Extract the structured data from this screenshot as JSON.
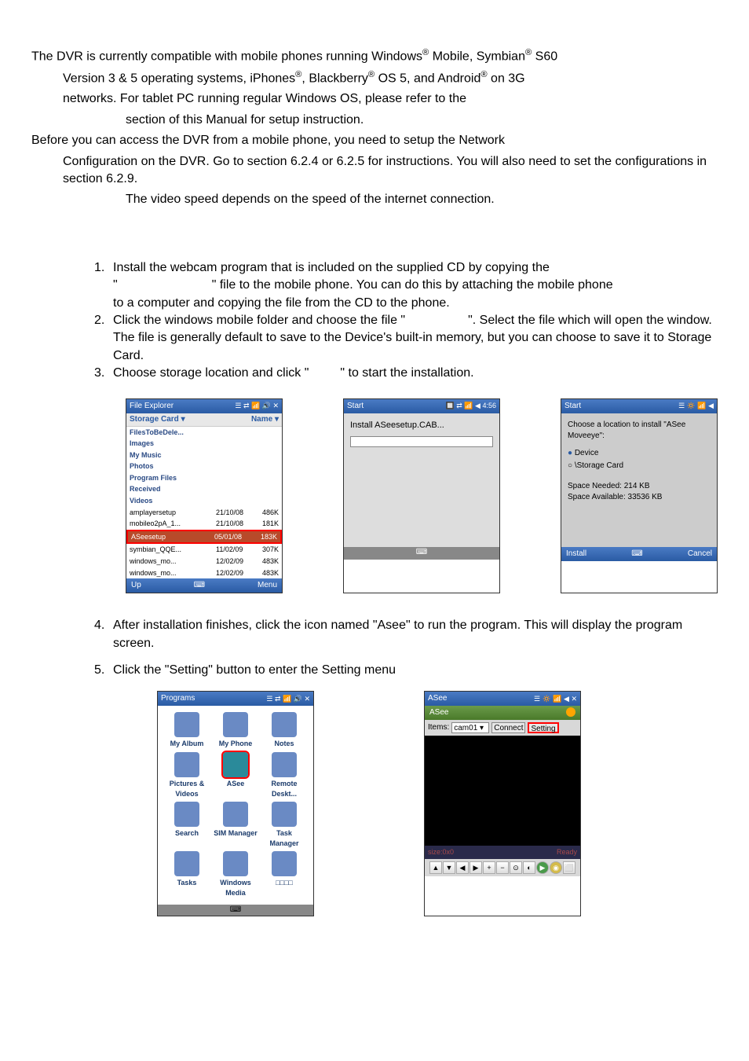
{
  "intro": {
    "p1a": "The DVR is currently compatible with mobile phones running Windows",
    "p1b": " Mobile, Symbian",
    "p1c": " S60",
    "p2a": "Version 3 & 5 operating systems, iPhones",
    "p2b": ", Blackberry",
    "p2c": " OS 5, and Android",
    "p2d": " on 3G",
    "p3": "networks.    For tablet PC running regular Windows OS, please refer to the",
    "p4": "section of this Manual for setup instruction.",
    "p5": "Before you can access the DVR from a mobile phone, you need to setup the Network",
    "p6": "Configuration on the DVR. Go to section 6.2.4 or 6.2.5 for instructions. You will also need to set the configurations in section 6.2.9.",
    "p7": "The video speed depends on the speed of the internet connection."
  },
  "steps": {
    "n1": "1.",
    "s1a": "Install the webcam program that is included on the supplied CD by copying the",
    "s1b": "\"",
    "s1c": "\" file to the mobile phone. You can do this by attaching the mobile phone",
    "s1d": "to a computer and copying the file from the CD to the phone.",
    "n2": "2.",
    "s2a": "Click the windows mobile folder and choose the file \"",
    "s2b": "\". Select the file which will open the window. The file is generally default to save to the Device's built-in memory, but you can choose to save it to Storage Card.",
    "n3": "3.",
    "s3a": "Choose storage location and click \"",
    "s3b": "\" to start the installation.",
    "n4": "4.",
    "s4": "After installation finishes, click the icon named \"Asee\" to run the program. This will display the program screen.",
    "n5": "5.",
    "s5": "Click the \"Setting\" button to enter the Setting menu"
  },
  "shot1": {
    "title": "File Explorer",
    "icons": "☰ ⇄ 📶 🔊 ✕",
    "dropdown": "Storage Card ▾",
    "nameCol": "Name ▾",
    "folders": [
      "FilesToBeDele...",
      "Images",
      "My Music",
      "Photos",
      "Program Files",
      "Received",
      "Videos"
    ],
    "files": [
      {
        "name": "amplayersetup",
        "date": "21/10/08",
        "size": "486K"
      },
      {
        "name": "mobileo2pA_1...",
        "date": "21/10/08",
        "size": "181K"
      },
      {
        "name": "ASeesetup",
        "date": "05/01/08",
        "size": "183K"
      },
      {
        "name": "symbian_QQE...",
        "date": "11/02/09",
        "size": "307K"
      },
      {
        "name": "windows_mo...",
        "date": "12/02/09",
        "size": "483K"
      },
      {
        "name": "windows_mo...",
        "date": "12/02/09",
        "size": "483K"
      }
    ],
    "btnLeft": "Up",
    "btnRight": "Menu"
  },
  "shot2": {
    "title": "Start",
    "icons": "🔲 ⇄ 📶 ◀ 4:56",
    "text": "Install ASeesetup.CAB..."
  },
  "shot3": {
    "title": "Start",
    "icons": "☰ 🔅 📶 ◀",
    "text": "Choose a location to install \"ASee Moveeye\":",
    "opt1": "Device",
    "opt2": "\\Storage Card",
    "needed": "Space Needed:  214 KB",
    "avail": "Space Available: 33536 KB",
    "btnLeft": "Install",
    "btnRight": "Cancel"
  },
  "shot4": {
    "title": "Programs",
    "icons": "☰ ⇄ 📶 🔊 ✕",
    "items": [
      "My Album",
      "My Phone",
      "Notes",
      "Pictures & Videos",
      "ASee",
      "Remote Deskt...",
      "Search",
      "SIM Manager",
      "Task Manager",
      "Tasks",
      "Windows Media",
      "□□□□"
    ]
  },
  "shot5": {
    "title": "ASee",
    "icons": "☰ 🔅 📶 ◀ ✕",
    "tab": "ASee",
    "itemsLabel": "Items:",
    "itemsVal": "cam01",
    "connectBtn": "Connect",
    "settingBtn": "Setting",
    "size": "size:0x0",
    "ready": "Ready"
  },
  "reg": "®"
}
